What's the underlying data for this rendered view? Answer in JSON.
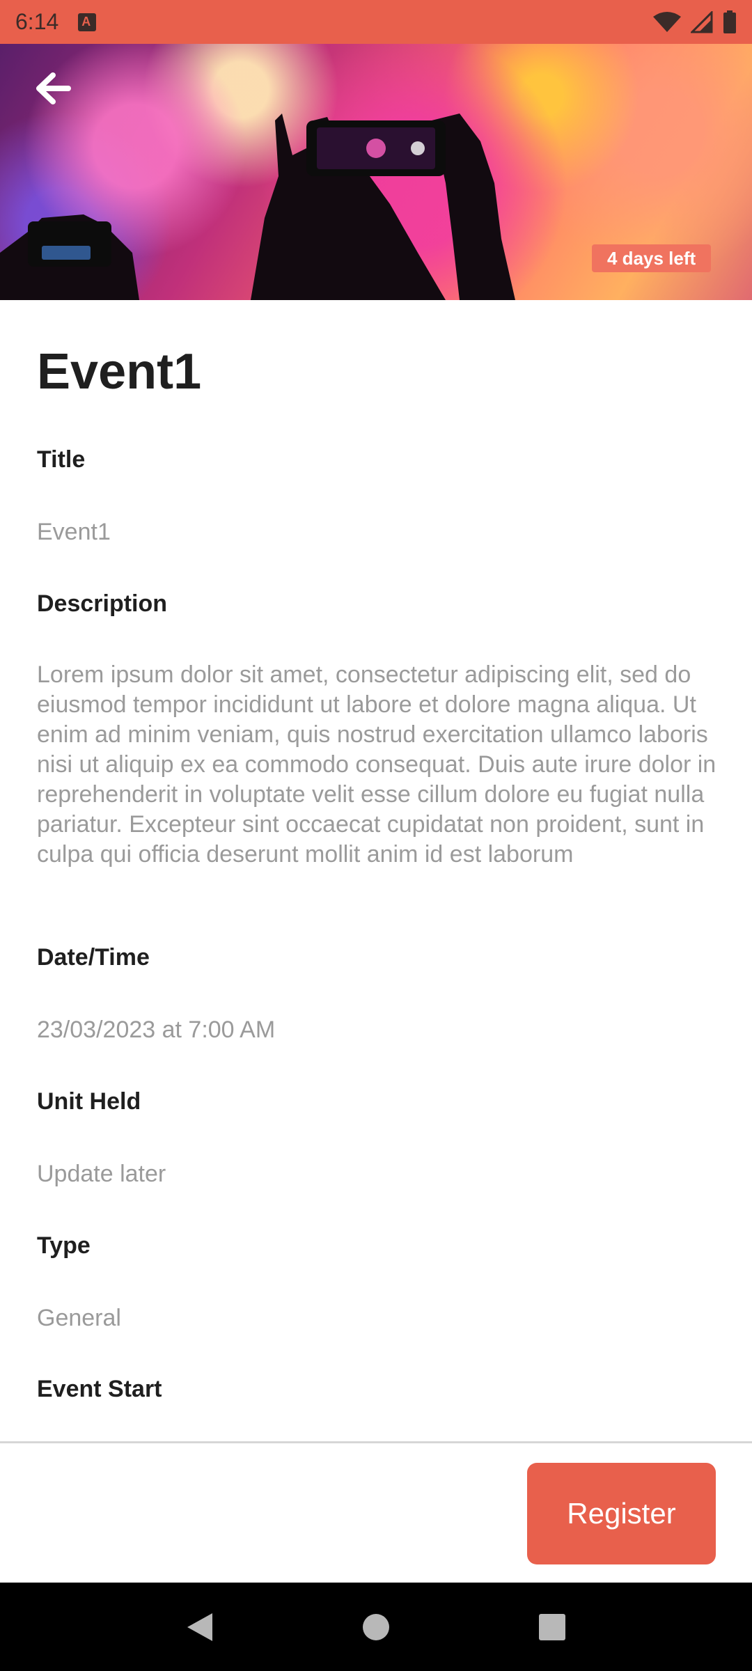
{
  "status_bar": {
    "time": "6:14",
    "icons": [
      "app-notification-icon",
      "wifi-icon",
      "signal-icon",
      "battery-icon"
    ]
  },
  "hero": {
    "back_icon": "arrow-left-icon",
    "days_left": "4 days left"
  },
  "event": {
    "heading": "Event1",
    "fields": [
      {
        "label": "Title",
        "value": "Event1"
      },
      {
        "label": "Description",
        "value": "Lorem ipsum dolor sit amet, consectetur adipiscing elit, sed do eiusmod tempor incididunt ut labore et dolore magna aliqua. Ut enim ad minim veniam, quis nostrud exercitation ullamco laboris nisi ut aliquip ex ea commodo consequat. Duis aute irure dolor in reprehenderit in voluptate velit esse cillum dolore eu fugiat nulla pariatur. Excepteur sint occaecat cupidatat non proident, sunt in culpa qui officia deserunt mollit anim id est laborum"
      },
      {
        "label": "Date/Time",
        "value": "23/03/2023 at 7:00 AM"
      },
      {
        "label": "Unit Held",
        "value": "Update later"
      },
      {
        "label": "Type",
        "value": "General"
      },
      {
        "label": "Event Start",
        "value": ""
      }
    ]
  },
  "actions": {
    "register_label": "Register"
  },
  "colors": {
    "accent": "#E8604C",
    "badge": "#F0735F",
    "label_text": "#1f1f1f",
    "value_text": "#9a9a9a"
  },
  "nav_bar": {
    "icons": [
      "back-triangle-icon",
      "home-circle-icon",
      "recents-square-icon"
    ]
  }
}
